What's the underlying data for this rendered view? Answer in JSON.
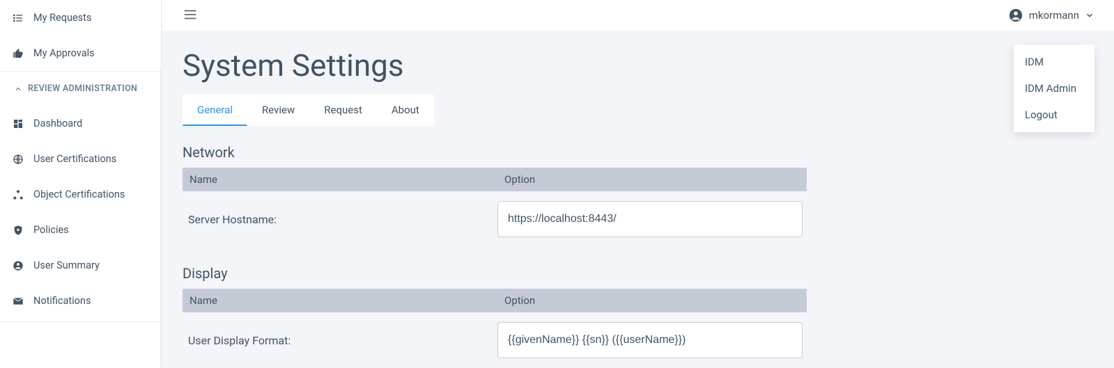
{
  "sidebar": {
    "top_items": [
      {
        "label": "My Requests",
        "icon": "list-icon"
      },
      {
        "label": "My Approvals",
        "icon": "thumb-up-icon"
      }
    ],
    "section_header": "REVIEW ADMINISTRATION",
    "admin_items": [
      {
        "label": "Dashboard",
        "icon": "dashboard-icon"
      },
      {
        "label": "User Certifications",
        "icon": "globe-user-icon"
      },
      {
        "label": "Object Certifications",
        "icon": "object-cert-icon"
      },
      {
        "label": "Policies",
        "icon": "shield-icon"
      },
      {
        "label": "User Summary",
        "icon": "account-icon"
      },
      {
        "label": "Notifications",
        "icon": "mail-icon"
      }
    ]
  },
  "header": {
    "username": "mkormann",
    "dropdown": [
      "IDM",
      "IDM Admin",
      "Logout"
    ]
  },
  "page": {
    "title": "System Settings",
    "tabs": [
      "General",
      "Review",
      "Request",
      "About"
    ],
    "active_tab": 0,
    "sections": [
      {
        "title": "Network",
        "columns": [
          "Name",
          "Option"
        ],
        "rows": [
          {
            "name": "Server Hostname:",
            "value": "https://localhost:8443/"
          }
        ]
      },
      {
        "title": "Display",
        "columns": [
          "Name",
          "Option"
        ],
        "rows": [
          {
            "name": "User Display Format:",
            "value": "{{givenName}} {{sn}} ({{userName}})"
          }
        ]
      }
    ]
  }
}
